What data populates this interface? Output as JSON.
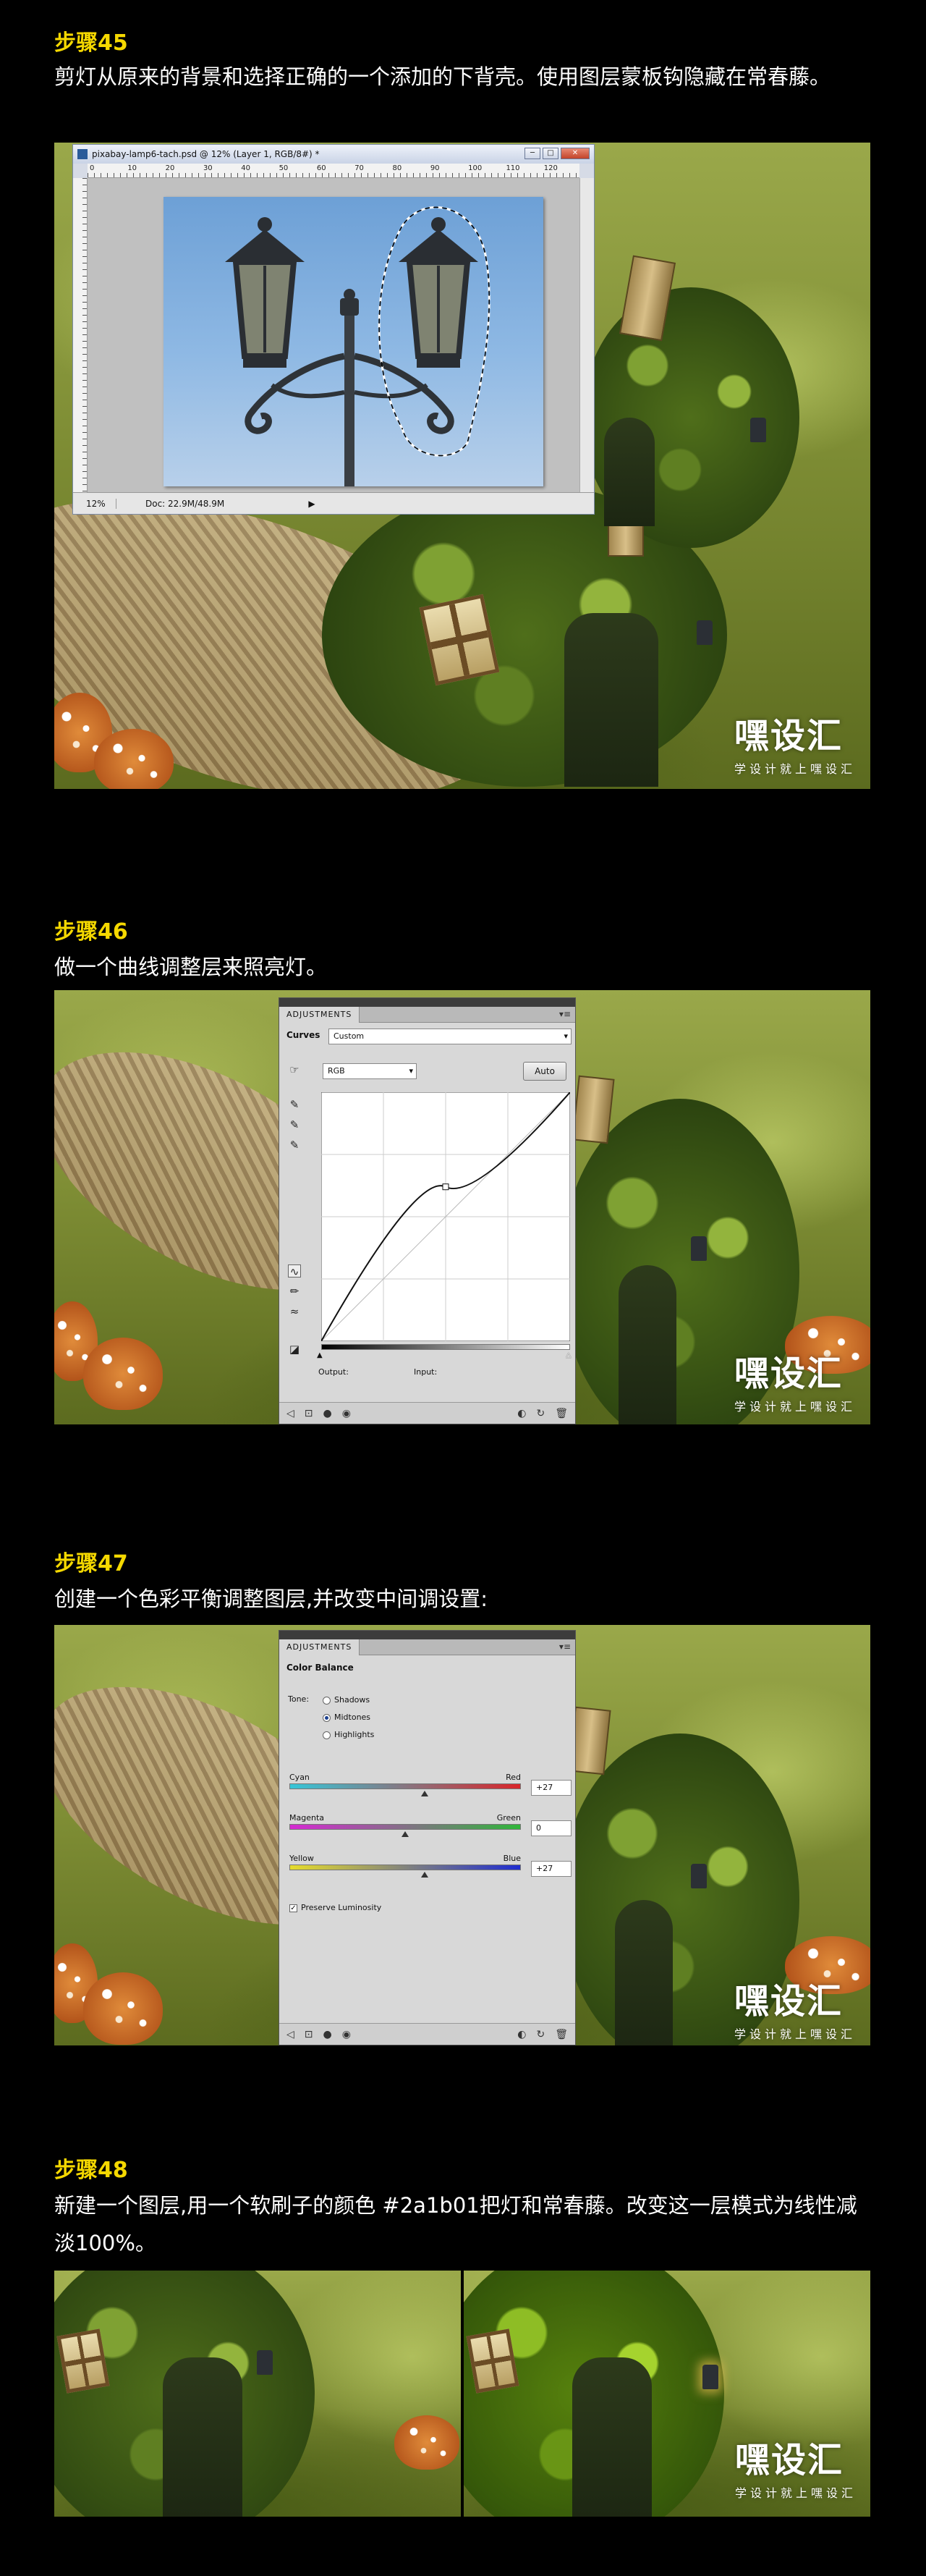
{
  "step45": {
    "title": "步骤45",
    "text": "剪灯从原来的背景和选择正确的一个添加的下背壳。使用图层蒙板钩隐藏在常春藤。",
    "ps_window": {
      "title": "pixabay-lamp6-tach.psd @ 12% (Layer 1, RGB/8#) *",
      "ruler_labels": [
        "0",
        "10",
        "20",
        "30",
        "40",
        "50",
        "60",
        "70",
        "80",
        "90",
        "100",
        "110",
        "120"
      ],
      "zoom": "12%",
      "doc": "Doc: 22.9M/48.9M",
      "win_buttons": [
        "─",
        "□",
        "✕"
      ]
    },
    "watermark": {
      "main": "嘿设汇",
      "sub": "学设计就上嘿设汇"
    }
  },
  "step46": {
    "title": "步骤46",
    "text": "做一个曲线调整层来照亮灯。",
    "panel": {
      "tab": "ADJUSTMENTS",
      "name": "Curves",
      "preset": "Custom",
      "channel": "RGB",
      "auto": "Auto",
      "output_label": "Output:",
      "input_label": "Input:"
    },
    "curve_points": [
      [
        0,
        0
      ],
      [
        0.5,
        0.62
      ],
      [
        1,
        1
      ]
    ],
    "watermark": {
      "main": "嘿设汇",
      "sub": "学设计就上嘿设汇"
    }
  },
  "step47": {
    "title": "步骤47",
    "text": "创建一个色彩平衡调整图层,并改变中间调设置:",
    "panel": {
      "tab": "ADJUSTMENTS",
      "name": "Color Balance",
      "tone_label": "Tone:",
      "tones": [
        "Shadows",
        "Midtones",
        "Highlights"
      ],
      "selected_tone": "Midtones",
      "sliders": [
        {
          "left": "Cyan",
          "right": "Red",
          "value": "+27",
          "pos": 0.585
        },
        {
          "left": "Magenta",
          "right": "Green",
          "value": "0",
          "pos": 0.5
        },
        {
          "left": "Yellow",
          "right": "Blue",
          "value": "+27",
          "pos": 0.585
        }
      ],
      "preserve": "Preserve Luminosity",
      "preserve_checked": true
    },
    "watermark": {
      "main": "嘿设汇",
      "sub": "学设计就上嘿设汇"
    }
  },
  "step48": {
    "title": "步骤48",
    "text": "新建一个图层,用一个软刷子的颜色 #2a1b01把灯和常春藤。改变这一层模式为线性减淡100%。",
    "watermark": {
      "main": "嘿设汇",
      "sub": "学设计就上嘿设汇"
    }
  },
  "colors": {
    "title": "#f5d800",
    "background": "#000000",
    "brush": "#2a1b01"
  }
}
